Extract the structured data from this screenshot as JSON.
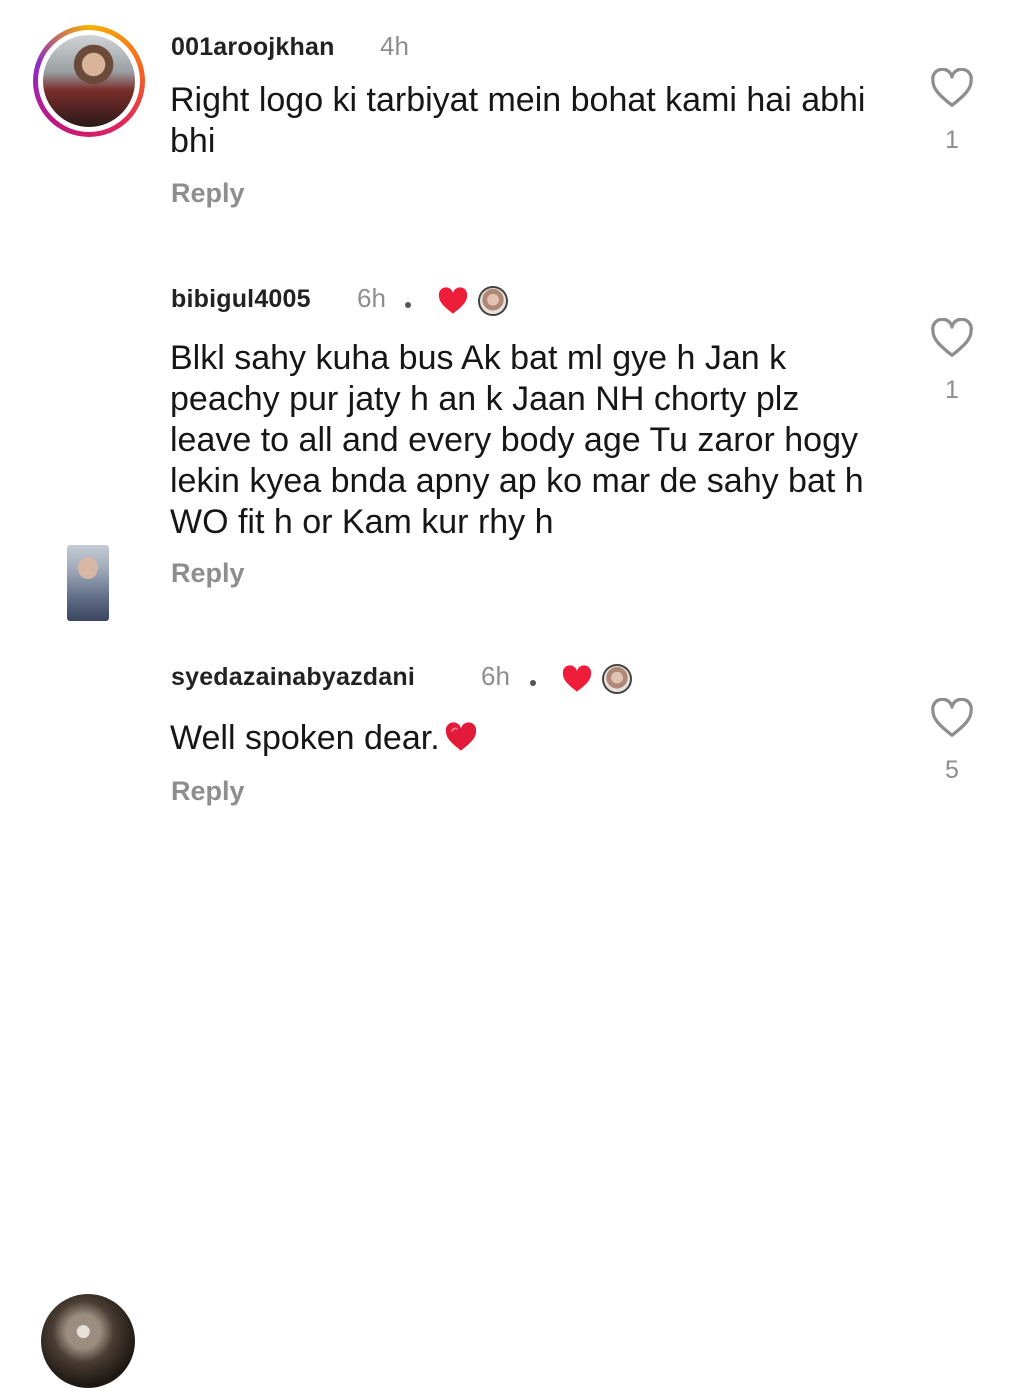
{
  "comments": [
    {
      "username": "001aroojkhan",
      "time": "4h",
      "text": "Right logo ki tarbiyat mein bohat kami hai abhi bhi",
      "reply": "Reply",
      "likes": "1",
      "has_story_ring": true
    },
    {
      "username": "bibigul4005",
      "time": "6h",
      "text": "Blkl sahy kuha bus Ak bat ml gye h Jan k peachy pur jaty h an k Jaan NH chorty plz leave to all and every body age Tu zaror hogy lekin kyea bnda apny ap ko mar de sahy bat h WO fit h or Kam kur rhy h",
      "reply": "Reply",
      "likes": "1",
      "liked_by_creator": true
    },
    {
      "username": "syedazainabyazdani",
      "time": "6h",
      "text": "Well spoken dear.",
      "reply": "Reply",
      "likes": "5",
      "liked_by_creator": true,
      "emoji": "red-heart"
    }
  ],
  "colors": {
    "heart_red": "#ee1d3a",
    "muted_gray": "#8e8e8e",
    "text": "#161616"
  }
}
